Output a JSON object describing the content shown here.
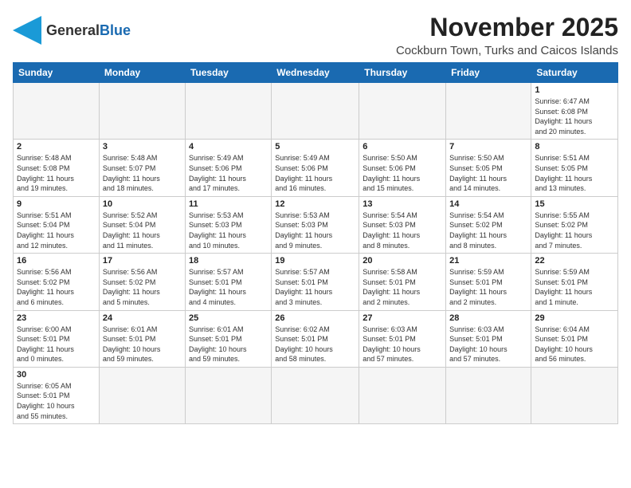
{
  "header": {
    "logo_general": "General",
    "logo_blue": "Blue",
    "month_year": "November 2025",
    "location": "Cockburn Town, Turks and Caicos Islands"
  },
  "weekdays": [
    "Sunday",
    "Monday",
    "Tuesday",
    "Wednesday",
    "Thursday",
    "Friday",
    "Saturday"
  ],
  "weeks": [
    [
      {
        "day": "",
        "info": ""
      },
      {
        "day": "",
        "info": ""
      },
      {
        "day": "",
        "info": ""
      },
      {
        "day": "",
        "info": ""
      },
      {
        "day": "",
        "info": ""
      },
      {
        "day": "",
        "info": ""
      },
      {
        "day": "1",
        "info": "Sunrise: 6:47 AM\nSunset: 6:08 PM\nDaylight: 11 hours\nand 20 minutes."
      }
    ],
    [
      {
        "day": "2",
        "info": "Sunrise: 5:48 AM\nSunset: 5:08 PM\nDaylight: 11 hours\nand 19 minutes."
      },
      {
        "day": "3",
        "info": "Sunrise: 5:48 AM\nSunset: 5:07 PM\nDaylight: 11 hours\nand 18 minutes."
      },
      {
        "day": "4",
        "info": "Sunrise: 5:49 AM\nSunset: 5:06 PM\nDaylight: 11 hours\nand 17 minutes."
      },
      {
        "day": "5",
        "info": "Sunrise: 5:49 AM\nSunset: 5:06 PM\nDaylight: 11 hours\nand 16 minutes."
      },
      {
        "day": "6",
        "info": "Sunrise: 5:50 AM\nSunset: 5:06 PM\nDaylight: 11 hours\nand 15 minutes."
      },
      {
        "day": "7",
        "info": "Sunrise: 5:50 AM\nSunset: 5:05 PM\nDaylight: 11 hours\nand 14 minutes."
      },
      {
        "day": "8",
        "info": "Sunrise: 5:51 AM\nSunset: 5:05 PM\nDaylight: 11 hours\nand 13 minutes."
      }
    ],
    [
      {
        "day": "9",
        "info": "Sunrise: 5:51 AM\nSunset: 5:04 PM\nDaylight: 11 hours\nand 12 minutes."
      },
      {
        "day": "10",
        "info": "Sunrise: 5:52 AM\nSunset: 5:04 PM\nDaylight: 11 hours\nand 11 minutes."
      },
      {
        "day": "11",
        "info": "Sunrise: 5:53 AM\nSunset: 5:03 PM\nDaylight: 11 hours\nand 10 minutes."
      },
      {
        "day": "12",
        "info": "Sunrise: 5:53 AM\nSunset: 5:03 PM\nDaylight: 11 hours\nand 9 minutes."
      },
      {
        "day": "13",
        "info": "Sunrise: 5:54 AM\nSunset: 5:03 PM\nDaylight: 11 hours\nand 8 minutes."
      },
      {
        "day": "14",
        "info": "Sunrise: 5:54 AM\nSunset: 5:02 PM\nDaylight: 11 hours\nand 8 minutes."
      },
      {
        "day": "15",
        "info": "Sunrise: 5:55 AM\nSunset: 5:02 PM\nDaylight: 11 hours\nand 7 minutes."
      }
    ],
    [
      {
        "day": "16",
        "info": "Sunrise: 5:56 AM\nSunset: 5:02 PM\nDaylight: 11 hours\nand 6 minutes."
      },
      {
        "day": "17",
        "info": "Sunrise: 5:56 AM\nSunset: 5:02 PM\nDaylight: 11 hours\nand 5 minutes."
      },
      {
        "day": "18",
        "info": "Sunrise: 5:57 AM\nSunset: 5:01 PM\nDaylight: 11 hours\nand 4 minutes."
      },
      {
        "day": "19",
        "info": "Sunrise: 5:57 AM\nSunset: 5:01 PM\nDaylight: 11 hours\nand 3 minutes."
      },
      {
        "day": "20",
        "info": "Sunrise: 5:58 AM\nSunset: 5:01 PM\nDaylight: 11 hours\nand 2 minutes."
      },
      {
        "day": "21",
        "info": "Sunrise: 5:59 AM\nSunset: 5:01 PM\nDaylight: 11 hours\nand 2 minutes."
      },
      {
        "day": "22",
        "info": "Sunrise: 5:59 AM\nSunset: 5:01 PM\nDaylight: 11 hours\nand 1 minute."
      }
    ],
    [
      {
        "day": "23",
        "info": "Sunrise: 6:00 AM\nSunset: 5:01 PM\nDaylight: 11 hours\nand 0 minutes."
      },
      {
        "day": "24",
        "info": "Sunrise: 6:01 AM\nSunset: 5:01 PM\nDaylight: 10 hours\nand 59 minutes."
      },
      {
        "day": "25",
        "info": "Sunrise: 6:01 AM\nSunset: 5:01 PM\nDaylight: 10 hours\nand 59 minutes."
      },
      {
        "day": "26",
        "info": "Sunrise: 6:02 AM\nSunset: 5:01 PM\nDaylight: 10 hours\nand 58 minutes."
      },
      {
        "day": "27",
        "info": "Sunrise: 6:03 AM\nSunset: 5:01 PM\nDaylight: 10 hours\nand 57 minutes."
      },
      {
        "day": "28",
        "info": "Sunrise: 6:03 AM\nSunset: 5:01 PM\nDaylight: 10 hours\nand 57 minutes."
      },
      {
        "day": "29",
        "info": "Sunrise: 6:04 AM\nSunset: 5:01 PM\nDaylight: 10 hours\nand 56 minutes."
      }
    ],
    [
      {
        "day": "30",
        "info": "Sunrise: 6:05 AM\nSunset: 5:01 PM\nDaylight: 10 hours\nand 55 minutes."
      },
      {
        "day": "",
        "info": ""
      },
      {
        "day": "",
        "info": ""
      },
      {
        "day": "",
        "info": ""
      },
      {
        "day": "",
        "info": ""
      },
      {
        "day": "",
        "info": ""
      },
      {
        "day": "",
        "info": ""
      }
    ]
  ]
}
